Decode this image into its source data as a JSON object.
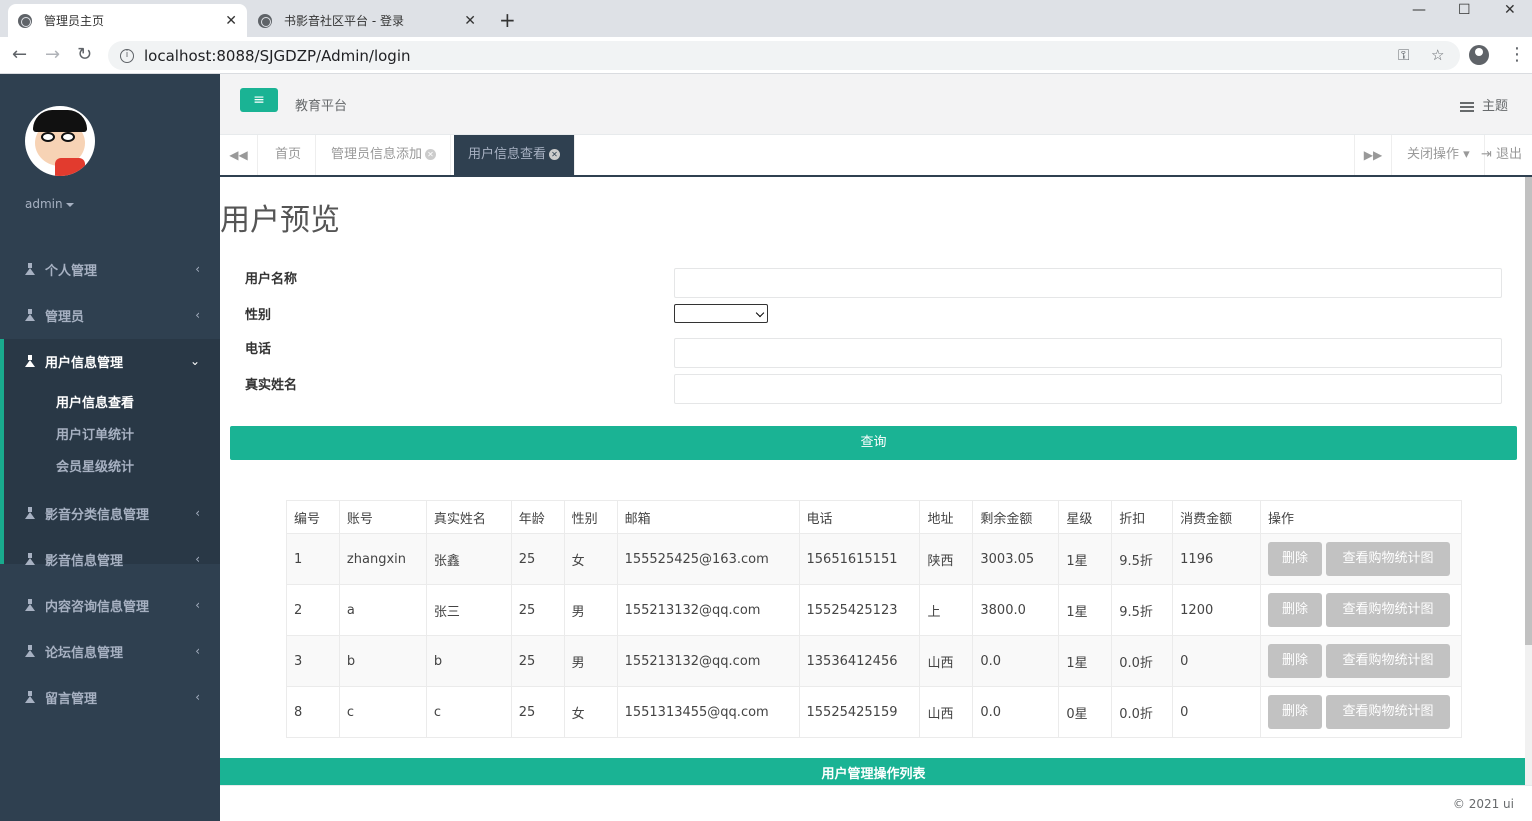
{
  "browser": {
    "tabs": [
      {
        "title": "管理员主页",
        "close": "✕"
      },
      {
        "title": "书影音社区平台 - 登录",
        "close": "✕"
      }
    ],
    "new_tab": "+",
    "url": "localhost:8088/SJGDZP/Admin/login",
    "window_controls": {
      "minimize": "—",
      "maximize": "☐",
      "close": "✕"
    }
  },
  "sidebar": {
    "username": "admin",
    "menu": [
      {
        "label": "个人管理",
        "chevron": "‹"
      },
      {
        "label": "管理员",
        "chevron": "‹"
      },
      {
        "label": "用户信息管理",
        "chevron": "⌄"
      },
      {
        "label": "影音分类信息管理",
        "chevron": "‹"
      },
      {
        "label": "影音信息管理",
        "chevron": "‹"
      },
      {
        "label": "内容咨询信息管理",
        "chevron": "‹"
      },
      {
        "label": "论坛信息管理",
        "chevron": "‹"
      },
      {
        "label": "留言管理",
        "chevron": "‹"
      }
    ],
    "submenu": [
      "用户信息查看",
      "用户订单统计",
      "会员星级统计"
    ]
  },
  "topbar": {
    "menu_icon": "≡",
    "brand": "教育平台",
    "theme": "主题"
  },
  "content_tabs": {
    "prev": "◀◀",
    "next": "▶▶",
    "tabs": [
      "首页",
      "管理员信息添加",
      "用户信息查看"
    ],
    "close_ops": "关闭操作",
    "logout": "退出"
  },
  "page": {
    "title": "用户预览",
    "form": {
      "username_label": "用户名称",
      "gender_label": "性别",
      "phone_label": "电话",
      "realname_label": "真实姓名"
    },
    "query_button": "查询",
    "table": {
      "headers": [
        "编号",
        "账号",
        "真实姓名",
        "年龄",
        "性别",
        "邮箱",
        "电话",
        "地址",
        "剩余金额",
        "星级",
        "折扣",
        "消费金额",
        "操作"
      ],
      "rows": [
        [
          "1",
          "zhangxin",
          "张鑫",
          "25",
          "女",
          "155525425@163.com",
          "15651615151",
          "陕西",
          "3003.05",
          "1星",
          "9.5折",
          "1196"
        ],
        [
          "2",
          "a",
          "张三",
          "25",
          "男",
          "155213132@qq.com",
          "15525425123",
          "上",
          "3800.0",
          "1星",
          "9.5折",
          "1200"
        ],
        [
          "3",
          "b",
          "b",
          "25",
          "男",
          "155213132@qq.com",
          "13536412456",
          "山西",
          "0.0",
          "1星",
          "0.0折",
          "0"
        ],
        [
          "8",
          "c",
          "c",
          "25",
          "女",
          "1551313455@qq.com",
          "15525425159",
          "山西",
          "0.0",
          "0星",
          "0.0折",
          "0"
        ]
      ],
      "delete_label": "删除",
      "chart_label": "查看购物统计图"
    },
    "ops_bar": "用户管理操作列表"
  },
  "footer": {
    "copyright": "© 2021 ui"
  }
}
